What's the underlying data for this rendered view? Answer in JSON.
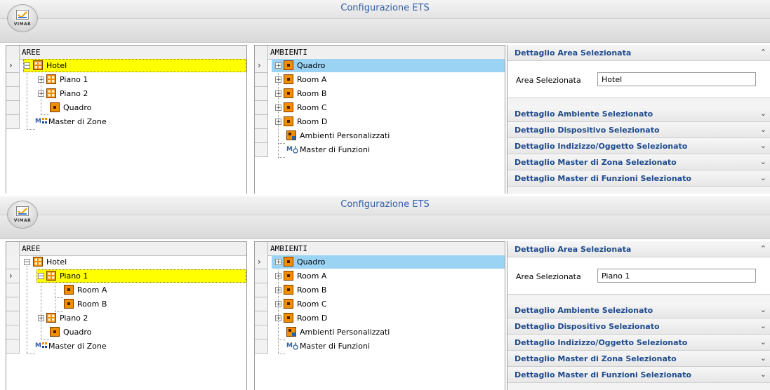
{
  "app_title": "Configurazione ETS",
  "logo_text": "VIMAR",
  "panels": {
    "areas_header": "AREE",
    "rooms_header": "AMBIENTI"
  },
  "screen1": {
    "areas": [
      "Hotel",
      "Piano 1",
      "Piano 2",
      "Quadro",
      "Master di Zone"
    ],
    "rooms": [
      "Quadro",
      "Room A",
      "Room B",
      "Room C",
      "Room D",
      "Ambienti Personalizzati",
      "Master di Funzioni"
    ],
    "field_label": "Area Selezionata",
    "field_value": "Hotel"
  },
  "screen2": {
    "areas": [
      "Hotel",
      "Piano 1",
      "Room A",
      "Room B",
      "Piano 2",
      "Quadro",
      "Master di Zone"
    ],
    "rooms": [
      "Quadro",
      "Room A",
      "Room B",
      "Room C",
      "Room D",
      "Ambienti Personalizzati",
      "Master di Funzioni"
    ],
    "field_label": "Area Selezionata",
    "field_value": "Piano 1"
  },
  "sections": [
    "Dettaglio Area Selezionata",
    "Dettaglio Ambiente Selezionato",
    "Dettaglio Dispositivo Selezionato",
    "Dettaglio Indizizzo/Oggetto Selezionato",
    "Dettaglio Master di Zona Selezionato",
    "Dettaglio Master di Funzioni Selezionato"
  ],
  "colors": {
    "title": "#2f5ea7",
    "section_label": "#1f4b8f",
    "selection_yellow": "#ffff00",
    "selection_blue": "#9bd3f5",
    "area_icon": "#f28c00",
    "area_icon_dark": "#7a3b00"
  },
  "icons": [
    "area-group-icon",
    "room-icon",
    "custom-room-icon",
    "master-zone-icon",
    "master-function-icon",
    "expand-icon",
    "collapse-icon",
    "row-selector-arrow-icon",
    "chevron-up-icon",
    "chevron-down-icon"
  ]
}
